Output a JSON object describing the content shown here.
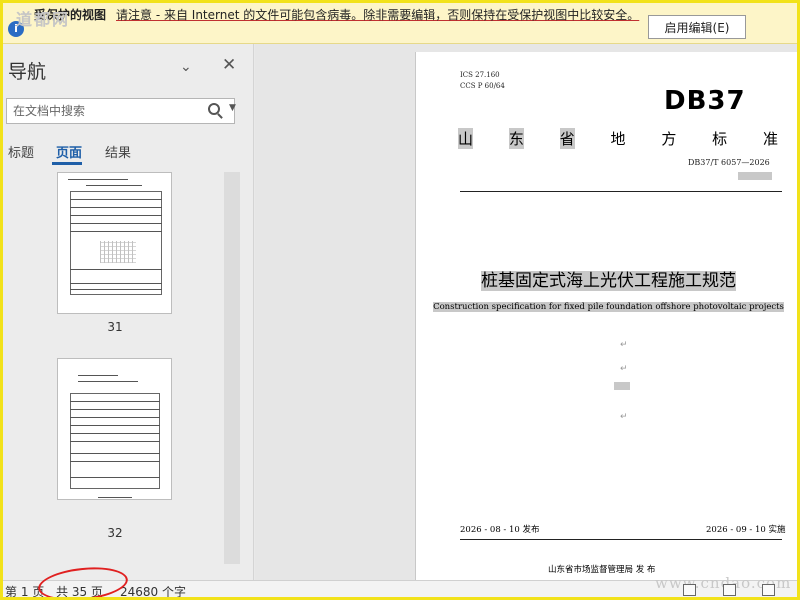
{
  "watermark": "道都网",
  "protected_view": {
    "title": "受保护的视图",
    "message": "请注意 - 来自 Internet 的文件可能包含病毒。除非需要编辑，否则保持在受保护视图中比较安全。",
    "enable_button": "启用编辑(E)"
  },
  "navigation": {
    "title": "导航",
    "search_placeholder": "在文档中搜索",
    "tabs": [
      {
        "label": "标题"
      },
      {
        "label": "页面"
      },
      {
        "label": "结果"
      }
    ],
    "active_tab": "页面",
    "thumbnails": [
      {
        "page": "31"
      },
      {
        "page": "32"
      }
    ]
  },
  "document": {
    "ics": "ICS  27.160",
    "ccs": "CCS  P 60/64",
    "db_code": "DB37",
    "province": [
      "山",
      "东",
      "省",
      "地",
      "方",
      "标",
      "准"
    ],
    "standard_no": "DB37/T 6057—2026",
    "title_cn": "桩基固定式海上光伏工程施工规范",
    "title_en": "Construction specification for fixed pile foundation offshore photovoltaic projects",
    "publish_date": "2026 - 08 - 10 发布",
    "implement_date": "2026 - 09 - 10 实施",
    "publisher": "山东省市场监督管理局      发 布"
  },
  "status_bar": {
    "page": "第 1 页",
    "total": "共 35 页",
    "words": "24680 个字"
  },
  "site_watermark": "www.cndao.com"
}
